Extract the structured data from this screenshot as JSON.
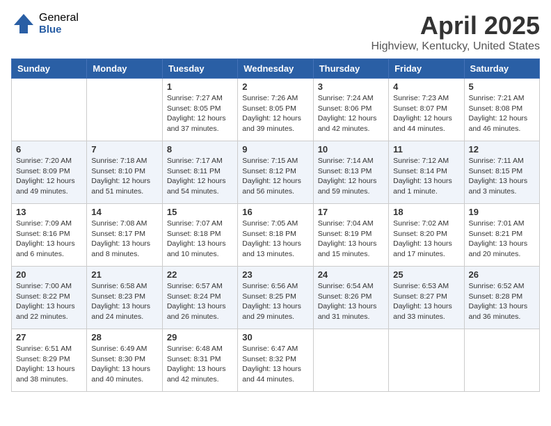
{
  "logo": {
    "general": "General",
    "blue": "Blue"
  },
  "header": {
    "title": "April 2025",
    "subtitle": "Highview, Kentucky, United States"
  },
  "weekdays": [
    "Sunday",
    "Monday",
    "Tuesday",
    "Wednesday",
    "Thursday",
    "Friday",
    "Saturday"
  ],
  "weeks": [
    [
      {
        "day": "",
        "sunrise": "",
        "sunset": "",
        "daylight": ""
      },
      {
        "day": "",
        "sunrise": "",
        "sunset": "",
        "daylight": ""
      },
      {
        "day": "1",
        "sunrise": "Sunrise: 7:27 AM",
        "sunset": "Sunset: 8:05 PM",
        "daylight": "Daylight: 12 hours and 37 minutes."
      },
      {
        "day": "2",
        "sunrise": "Sunrise: 7:26 AM",
        "sunset": "Sunset: 8:05 PM",
        "daylight": "Daylight: 12 hours and 39 minutes."
      },
      {
        "day": "3",
        "sunrise": "Sunrise: 7:24 AM",
        "sunset": "Sunset: 8:06 PM",
        "daylight": "Daylight: 12 hours and 42 minutes."
      },
      {
        "day": "4",
        "sunrise": "Sunrise: 7:23 AM",
        "sunset": "Sunset: 8:07 PM",
        "daylight": "Daylight: 12 hours and 44 minutes."
      },
      {
        "day": "5",
        "sunrise": "Sunrise: 7:21 AM",
        "sunset": "Sunset: 8:08 PM",
        "daylight": "Daylight: 12 hours and 46 minutes."
      }
    ],
    [
      {
        "day": "6",
        "sunrise": "Sunrise: 7:20 AM",
        "sunset": "Sunset: 8:09 PM",
        "daylight": "Daylight: 12 hours and 49 minutes."
      },
      {
        "day": "7",
        "sunrise": "Sunrise: 7:18 AM",
        "sunset": "Sunset: 8:10 PM",
        "daylight": "Daylight: 12 hours and 51 minutes."
      },
      {
        "day": "8",
        "sunrise": "Sunrise: 7:17 AM",
        "sunset": "Sunset: 8:11 PM",
        "daylight": "Daylight: 12 hours and 54 minutes."
      },
      {
        "day": "9",
        "sunrise": "Sunrise: 7:15 AM",
        "sunset": "Sunset: 8:12 PM",
        "daylight": "Daylight: 12 hours and 56 minutes."
      },
      {
        "day": "10",
        "sunrise": "Sunrise: 7:14 AM",
        "sunset": "Sunset: 8:13 PM",
        "daylight": "Daylight: 12 hours and 59 minutes."
      },
      {
        "day": "11",
        "sunrise": "Sunrise: 7:12 AM",
        "sunset": "Sunset: 8:14 PM",
        "daylight": "Daylight: 13 hours and 1 minute."
      },
      {
        "day": "12",
        "sunrise": "Sunrise: 7:11 AM",
        "sunset": "Sunset: 8:15 PM",
        "daylight": "Daylight: 13 hours and 3 minutes."
      }
    ],
    [
      {
        "day": "13",
        "sunrise": "Sunrise: 7:09 AM",
        "sunset": "Sunset: 8:16 PM",
        "daylight": "Daylight: 13 hours and 6 minutes."
      },
      {
        "day": "14",
        "sunrise": "Sunrise: 7:08 AM",
        "sunset": "Sunset: 8:17 PM",
        "daylight": "Daylight: 13 hours and 8 minutes."
      },
      {
        "day": "15",
        "sunrise": "Sunrise: 7:07 AM",
        "sunset": "Sunset: 8:18 PM",
        "daylight": "Daylight: 13 hours and 10 minutes."
      },
      {
        "day": "16",
        "sunrise": "Sunrise: 7:05 AM",
        "sunset": "Sunset: 8:18 PM",
        "daylight": "Daylight: 13 hours and 13 minutes."
      },
      {
        "day": "17",
        "sunrise": "Sunrise: 7:04 AM",
        "sunset": "Sunset: 8:19 PM",
        "daylight": "Daylight: 13 hours and 15 minutes."
      },
      {
        "day": "18",
        "sunrise": "Sunrise: 7:02 AM",
        "sunset": "Sunset: 8:20 PM",
        "daylight": "Daylight: 13 hours and 17 minutes."
      },
      {
        "day": "19",
        "sunrise": "Sunrise: 7:01 AM",
        "sunset": "Sunset: 8:21 PM",
        "daylight": "Daylight: 13 hours and 20 minutes."
      }
    ],
    [
      {
        "day": "20",
        "sunrise": "Sunrise: 7:00 AM",
        "sunset": "Sunset: 8:22 PM",
        "daylight": "Daylight: 13 hours and 22 minutes."
      },
      {
        "day": "21",
        "sunrise": "Sunrise: 6:58 AM",
        "sunset": "Sunset: 8:23 PM",
        "daylight": "Daylight: 13 hours and 24 minutes."
      },
      {
        "day": "22",
        "sunrise": "Sunrise: 6:57 AM",
        "sunset": "Sunset: 8:24 PM",
        "daylight": "Daylight: 13 hours and 26 minutes."
      },
      {
        "day": "23",
        "sunrise": "Sunrise: 6:56 AM",
        "sunset": "Sunset: 8:25 PM",
        "daylight": "Daylight: 13 hours and 29 minutes."
      },
      {
        "day": "24",
        "sunrise": "Sunrise: 6:54 AM",
        "sunset": "Sunset: 8:26 PM",
        "daylight": "Daylight: 13 hours and 31 minutes."
      },
      {
        "day": "25",
        "sunrise": "Sunrise: 6:53 AM",
        "sunset": "Sunset: 8:27 PM",
        "daylight": "Daylight: 13 hours and 33 minutes."
      },
      {
        "day": "26",
        "sunrise": "Sunrise: 6:52 AM",
        "sunset": "Sunset: 8:28 PM",
        "daylight": "Daylight: 13 hours and 36 minutes."
      }
    ],
    [
      {
        "day": "27",
        "sunrise": "Sunrise: 6:51 AM",
        "sunset": "Sunset: 8:29 PM",
        "daylight": "Daylight: 13 hours and 38 minutes."
      },
      {
        "day": "28",
        "sunrise": "Sunrise: 6:49 AM",
        "sunset": "Sunset: 8:30 PM",
        "daylight": "Daylight: 13 hours and 40 minutes."
      },
      {
        "day": "29",
        "sunrise": "Sunrise: 6:48 AM",
        "sunset": "Sunset: 8:31 PM",
        "daylight": "Daylight: 13 hours and 42 minutes."
      },
      {
        "day": "30",
        "sunrise": "Sunrise: 6:47 AM",
        "sunset": "Sunset: 8:32 PM",
        "daylight": "Daylight: 13 hours and 44 minutes."
      },
      {
        "day": "",
        "sunrise": "",
        "sunset": "",
        "daylight": ""
      },
      {
        "day": "",
        "sunrise": "",
        "sunset": "",
        "daylight": ""
      },
      {
        "day": "",
        "sunrise": "",
        "sunset": "",
        "daylight": ""
      }
    ]
  ]
}
